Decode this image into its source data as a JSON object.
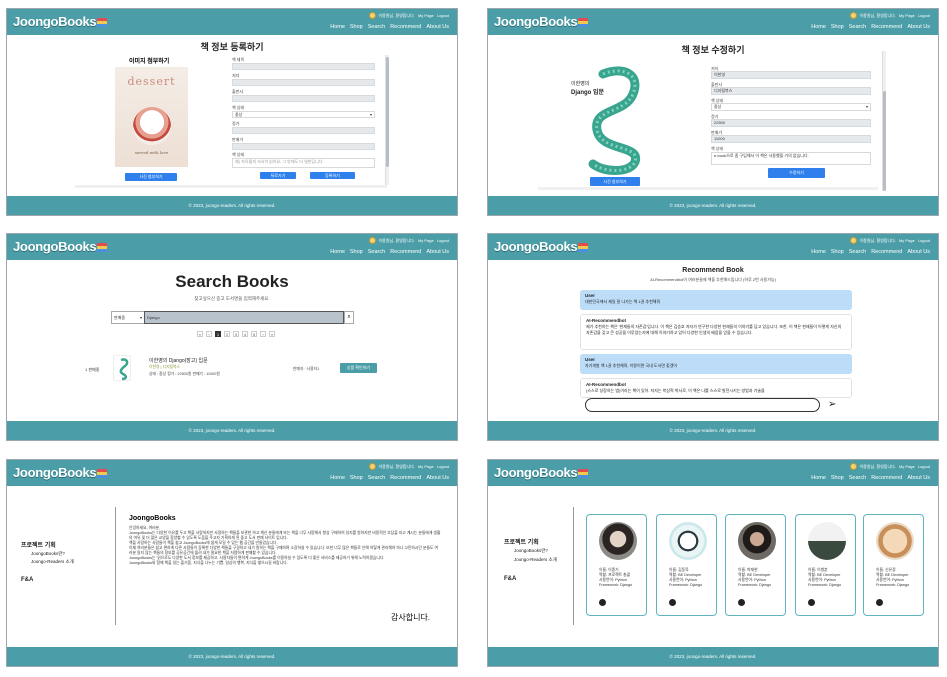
{
  "header": {
    "logo": "JoongoBooks",
    "user_greeting": "이종원님, 환영합니다.",
    "my_page": "My Page",
    "logout": "Logout",
    "nav": [
      "Home",
      "Shop",
      "Search",
      "Recommend",
      "About Us"
    ]
  },
  "footer": "© 2023, joongo-readers. All rights reserved.",
  "register": {
    "title": "책 정보 등록하기",
    "image_heading": "이미지 첨부하기",
    "cover_word": "dessert",
    "cover_sub": "served with love",
    "attach_button": "사진 첨부하기",
    "fields": [
      "책 제목",
      "저자",
      "출판사",
      "책 상태",
      "정가",
      "판매가",
      "책 상태"
    ],
    "status_value": "중상",
    "desc_placeholder": "예) 자유롭게 서서히 읽어요, 그 밖에도 더 엿한답니다.",
    "cancel": "뒤로가기",
    "submit": "등록하기"
  },
  "edit": {
    "title": "책 정보 수정하기",
    "cover_author": "이한영의",
    "cover_title": "Django 입문",
    "fields": [
      "저자",
      "출판사",
      "책 상태",
      "정가",
      "판매가",
      "책 상태"
    ],
    "values": [
      "이한영",
      "디지털북스",
      "중상",
      "22500",
      "11000",
      "e-book으로 좀 구입해서 이 책은 사용했을 거의 없습니다."
    ],
    "attach_button": "사진 첨부하기",
    "submit": "수정하기"
  },
  "search": {
    "title": "Search Books",
    "subtitle": "찾고싶으신 중고 도서명을 입력해주세요.",
    "filter": "판매중",
    "query": "Django",
    "pages": [
      "«",
      "‹",
      "1",
      "2",
      "3",
      "4",
      "5",
      "›",
      "»"
    ],
    "result_status": "1 판매중",
    "book_title": "이한영의 Django(장고) 입문",
    "book_meta1": "이한영 | 디지털북스",
    "book_meta2": "상태 : 중상  정가 : 22500원  판매가 : 11000원",
    "seller": "판매자 : 사용자1",
    "detail_button": "상품 확인하기"
  },
  "recommend": {
    "title": "Recommend Book",
    "subtitle": "AI-Recommendbot이 여러분들께 책을 추천해드립니다 (하루 2번 사용가능)",
    "messages": [
      {
        "role": "User",
        "text": "대한민국에서 제일 잘 나가는 책 1권 추천해줘"
      },
      {
        "role": "AI-Recommendbot",
        "text": "제가 추천하는 책은 '현재들의 자존감'입니다. 이 책은 김승호 저자가 연구한 다양한 현재들의 이야기를 담고 있습니다. 또한, 이 책은 현재들이 어떻게 자신의 자존감을 갖고 큰 성공을 이루었는지에 대해 이야기하고 있어 다양한 인생의 배움을 얻을 수 있습니다."
      },
      {
        "role": "User",
        "text": "자기개발 책 1권 추천해줘, 이왕이면 국내 도서면 좋겠어"
      },
      {
        "role": "AI-Recommendbot",
        "text": "(스스로 성장하는 법)이라는 책이 있어. 저자는 박상혁 박사로, 이 책은 나를 스스로 발전시키는 방법과 기술을"
      }
    ]
  },
  "about": {
    "menu_title": "프로젝트 기획",
    "menu_items": [
      "JoongoBooks란?",
      "Joongo-Readers 소개"
    ],
    "faq": "F&A",
    "heading": "JoongoBooks",
    "paragraphs": [
      "안녕하세요, 여러분.",
      "JoongoBooks는 다양한 이유를 두고 책을 사랑하지만 사정하는 책들을 보관한 하고 계신 분들에게 또는 책을 너무 사랑해서 항상 구매하여 읽지를 원하지만 비용적인 부담을 지고 계시는 분들에게 생활의 여유 및 더 많은 교양을 함양할 수 있도록 도움을 주고자 기획하게 된 중고 도서 판매 사이트 입니다.",
      "책을 사랑하는 사람들이 책을 쉽고 JoongoBooks에 쉽게 모일 수 있는 웹 공간을 만들었습니다.",
      "이제 여러분들은 쉽고 편하게 다른 사람들이 등록한 다양한 책들을 구경하고 내가 원하는 책을 구매하며 소장하실 수 있습니다. 또한 너무 많은 책들로 인해 어떻게 관리해야 하나 고민하시던 분들도 여러분 읽지 않는 책들의 정보를 공유공간에 올려 내가 필요한 책을 저렴하게 판매할 수 있습니다.",
      "JoongoBooks는 '읽으로도 다양한 도서 정보를 제공하고, 사용자들이 편하게 JoongoBooks를 이용하실 수 있도록 더 좋은 서비스를 제공하기 위해 노력하겠습니다.",
      "JoongoBooks와 함께 책을 읽는 즐거움, 지식을 나누는 기쁨, 일상의 행복, 지식을 쌓으시길 바랍니다."
    ],
    "thanks": "감사합니다."
  },
  "team": {
    "menu_title": "프로젝트 기획",
    "menu_items": [
      "JoongoBooks란?",
      "Joongo-Readers 소개"
    ],
    "faq": "F&A",
    "members": [
      {
        "info": "이름: 이종기\n역할: 프로젝트 총괄\n사용언어: Python\nFramework: Django"
      },
      {
        "info": "이름: 김동욱\n역할: BE Developer\n사용언어: Python\nFramework: Django"
      },
      {
        "info": "이름: 박재현\n역할: BE Developer\n사용언어: Python\nFramework: Django"
      },
      {
        "info": "이름: 이병훈\n역할: BE Developer\n사용언어: Python\nFramework: Django"
      },
      {
        "info": "이름: 신유정\n역할: BE Developer\n사용언어: Python\nFramework: Django"
      }
    ]
  },
  "colors": {
    "brand": "#4b9ea8",
    "button": "#2f80ed",
    "user_bubble": "#bcdcf7"
  }
}
